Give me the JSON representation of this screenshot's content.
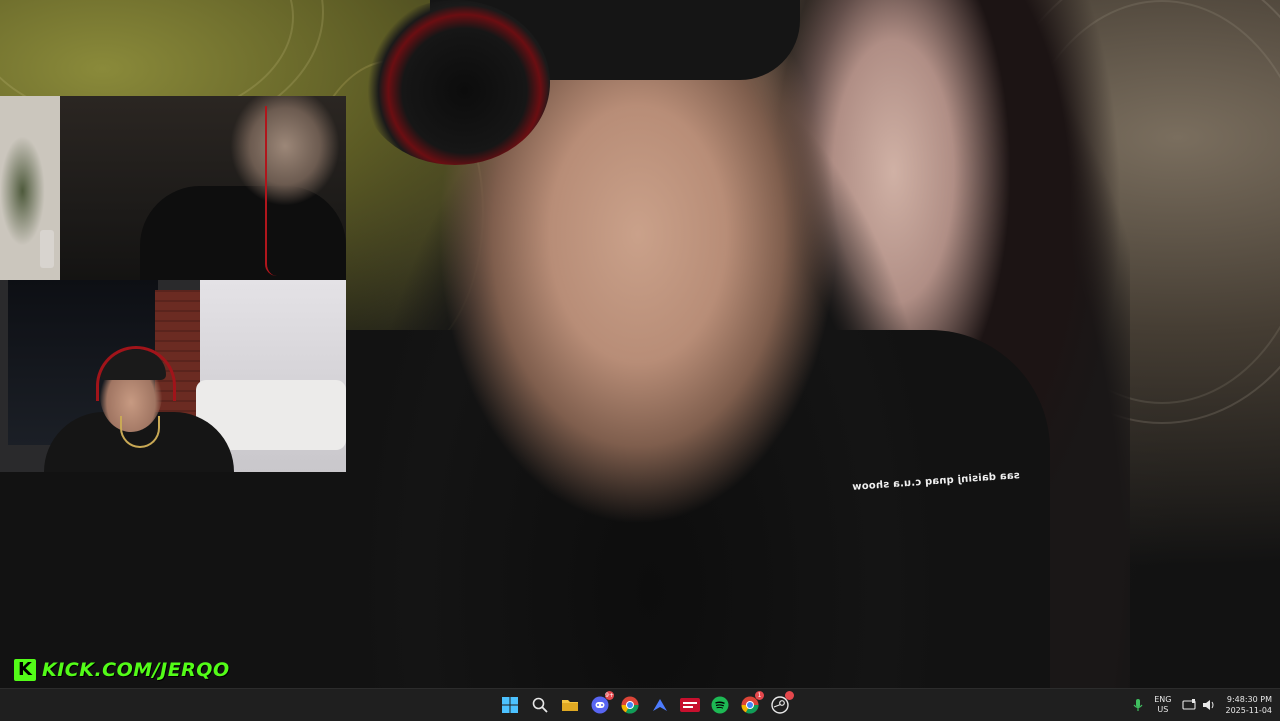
{
  "stream": {
    "caption_overlay": "saa daisinj qnaq c.u.a shoow",
    "kick_logo_letter": "K",
    "kick_url": "KICK.COM/JERQO"
  },
  "taskbar": {
    "apps": [
      {
        "name": "start-button",
        "icon": "windows-logo-icon"
      },
      {
        "name": "search-button",
        "icon": "search-icon"
      },
      {
        "name": "file-explorer-button",
        "icon": "folder-icon"
      },
      {
        "name": "discord-button",
        "icon": "discord-icon",
        "badge": "9+"
      },
      {
        "name": "chrome-button",
        "icon": "chrome-icon"
      },
      {
        "name": "vpn-button",
        "icon": "arrow-logo-icon"
      },
      {
        "name": "capture-app-button",
        "icon": "red-app-icon"
      },
      {
        "name": "spotify-button",
        "icon": "spotify-icon"
      },
      {
        "name": "chrome-profile-button",
        "icon": "chrome-icon",
        "badge": "1"
      },
      {
        "name": "steam-button",
        "icon": "steam-icon",
        "badge": ""
      }
    ],
    "language": {
      "line1": "ENG",
      "line2": "US"
    },
    "time": "9:48:30 PM",
    "date": "2025-11-04"
  },
  "colors": {
    "kick_green": "#53fc18",
    "taskbar_bg": "#1f1f1f",
    "headset_red": "#a1141a"
  }
}
